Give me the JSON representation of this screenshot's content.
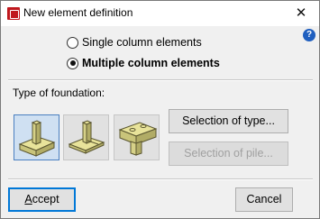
{
  "window": {
    "title": "New element definition",
    "close_glyph": "✕",
    "help_glyph": "?"
  },
  "options": {
    "single_label": "Single column elements",
    "multiple_label": "Multiple column elements",
    "selected": "multiple"
  },
  "foundation": {
    "section_label": "Type of foundation:",
    "types": [
      {
        "icon": "pad-footing-icon",
        "selected": true
      },
      {
        "icon": "pile-cap-footing-icon",
        "selected": false
      },
      {
        "icon": "pile-foundation-icon",
        "selected": false
      }
    ],
    "selection_of_type_label": "Selection of type...",
    "selection_of_pile_label": "Selection of pile..."
  },
  "footer": {
    "accept_first": "A",
    "accept_rest": "ccept",
    "cancel_label": "Cancel"
  },
  "colors": {
    "brand": "#c0181e",
    "accent": "#0078d7",
    "icon_fill": "#e8e39a",
    "icon_stroke": "#5a5630"
  }
}
